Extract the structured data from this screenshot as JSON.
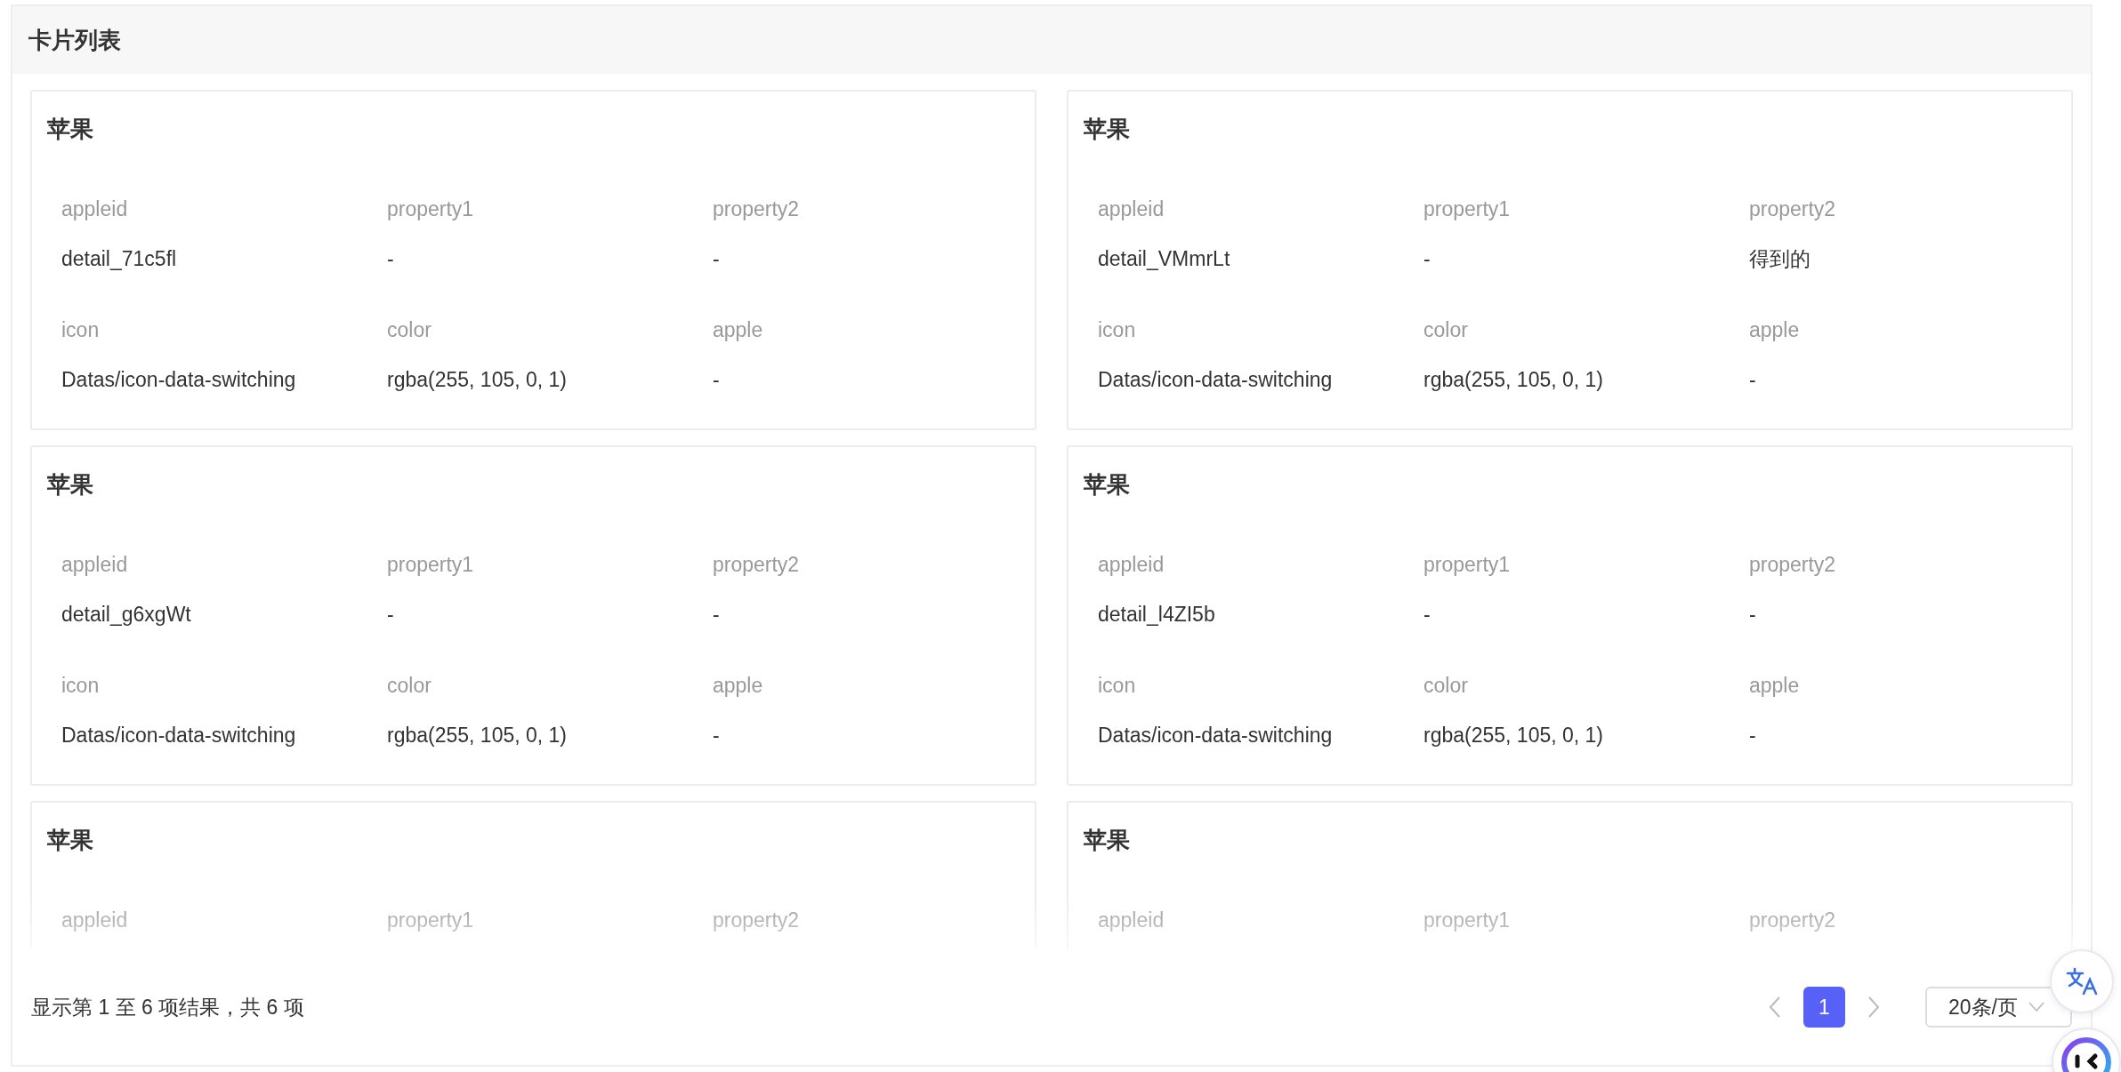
{
  "panel": {
    "title": "卡片列表"
  },
  "cards": [
    {
      "title": "苹果",
      "rows": [
        {
          "cells": [
            {
              "label": "appleid",
              "value": "detail_71c5fl"
            },
            {
              "label": "property1",
              "value": "-"
            },
            {
              "label": "property2",
              "value": "-"
            }
          ]
        },
        {
          "cells": [
            {
              "label": "icon",
              "value": "Datas/icon-data-switching"
            },
            {
              "label": "color",
              "value": "rgba(255, 105, 0, 1)"
            },
            {
              "label": "apple",
              "value": "-"
            }
          ]
        }
      ]
    },
    {
      "title": "苹果",
      "rows": [
        {
          "cells": [
            {
              "label": "appleid",
              "value": "detail_VMmrLt"
            },
            {
              "label": "property1",
              "value": "-"
            },
            {
              "label": "property2",
              "value": "得到的"
            }
          ]
        },
        {
          "cells": [
            {
              "label": "icon",
              "value": "Datas/icon-data-switching"
            },
            {
              "label": "color",
              "value": "rgba(255, 105, 0, 1)"
            },
            {
              "label": "apple",
              "value": "-"
            }
          ]
        }
      ]
    },
    {
      "title": "苹果",
      "rows": [
        {
          "cells": [
            {
              "label": "appleid",
              "value": "detail_g6xgWt"
            },
            {
              "label": "property1",
              "value": "-"
            },
            {
              "label": "property2",
              "value": "-"
            }
          ]
        },
        {
          "cells": [
            {
              "label": "icon",
              "value": "Datas/icon-data-switching"
            },
            {
              "label": "color",
              "value": "rgba(255, 105, 0, 1)"
            },
            {
              "label": "apple",
              "value": "-"
            }
          ]
        }
      ]
    },
    {
      "title": "苹果",
      "rows": [
        {
          "cells": [
            {
              "label": "appleid",
              "value": "detail_l4ZI5b"
            },
            {
              "label": "property1",
              "value": "-"
            },
            {
              "label": "property2",
              "value": "-"
            }
          ]
        },
        {
          "cells": [
            {
              "label": "icon",
              "value": "Datas/icon-data-switching"
            },
            {
              "label": "color",
              "value": "rgba(255, 105, 0, 1)"
            },
            {
              "label": "apple",
              "value": "-"
            }
          ]
        }
      ]
    },
    {
      "title": "苹果",
      "rows": [
        {
          "cells": [
            {
              "label": "appleid"
            },
            {
              "label": "property1"
            },
            {
              "label": "property2"
            }
          ]
        }
      ]
    },
    {
      "title": "苹果",
      "rows": [
        {
          "cells": [
            {
              "label": "appleid"
            },
            {
              "label": "property1"
            },
            {
              "label": "property2"
            }
          ]
        }
      ]
    }
  ],
  "footer": {
    "summary": "显示第 1 至 6 项结果，共 6 项",
    "pages": [
      {
        "label": "1",
        "selected": true
      }
    ],
    "page_size": "20条/页"
  }
}
